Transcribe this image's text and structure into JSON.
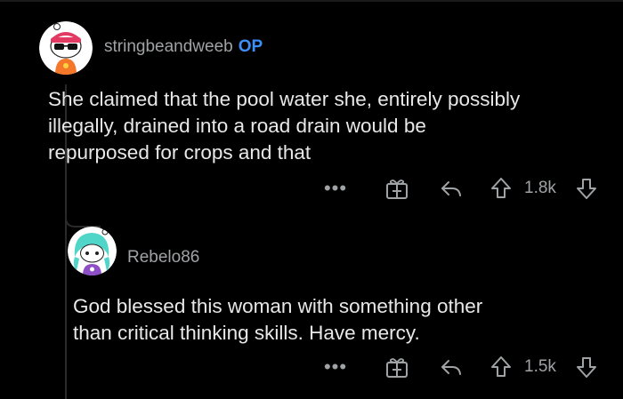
{
  "comments": [
    {
      "username": "stringbeandweeb",
      "op_label": "OP",
      "body_lines": [
        "She claimed that the pool water she, entirely possibly",
        "illegally, drained into a road drain would be",
        "repurposed for crops and that"
      ],
      "score": "1.8k"
    },
    {
      "username": "Rebelo86",
      "body_lines": [
        "God blessed this woman with something other",
        "than critical thinking skills. Have mercy."
      ],
      "score": "1.5k"
    }
  ],
  "more_label": "•••",
  "icons": {
    "more": "more-options-icon",
    "award": "award-gift-icon",
    "reply": "reply-icon",
    "upvote": "upvote-arrow-icon",
    "downvote": "downvote-arrow-icon"
  },
  "colors": {
    "background": "#000000",
    "text": "#e8e8e8",
    "muted": "#a0a3a5",
    "op_badge": "#3e8ef7"
  }
}
